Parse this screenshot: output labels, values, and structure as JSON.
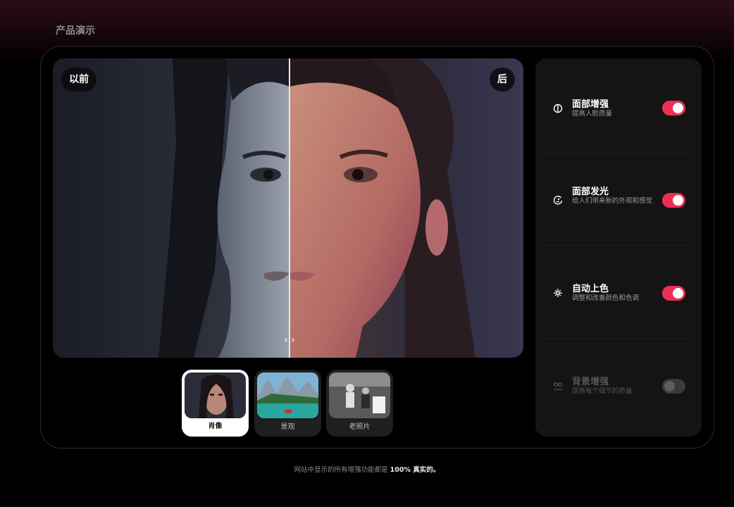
{
  "section_title": "产品演示",
  "compare": {
    "before_label": "以前",
    "after_label": "后",
    "handle_glyph": "‹ ›"
  },
  "thumbnails": [
    {
      "label": "肖像",
      "active": true
    },
    {
      "label": "景观",
      "active": false
    },
    {
      "label": "老照片",
      "active": false
    }
  ],
  "features": [
    {
      "title": "面部增强",
      "desc": "提高人脸质量",
      "icon": "face-enhance-icon",
      "enabled": true
    },
    {
      "title": "面部发光",
      "desc": "给人们带来新的外观和感觉",
      "icon": "face-glow-icon",
      "enabled": true
    },
    {
      "title": "自动上色",
      "desc": "调整和改善颜色和色调",
      "icon": "sparkle-icon",
      "enabled": true
    },
    {
      "title": "背景增强",
      "desc": "提高每个细节的质量",
      "icon": "background-icon",
      "enabled": false
    }
  ],
  "footer": {
    "text_prefix": "网站中显示的所有增强功能都是 ",
    "text_emph": "100% 真实的。"
  },
  "colors": {
    "toggle_on": "#ee2f54",
    "toggle_off": "#3a3a3a",
    "panel_bg": "#141414"
  }
}
